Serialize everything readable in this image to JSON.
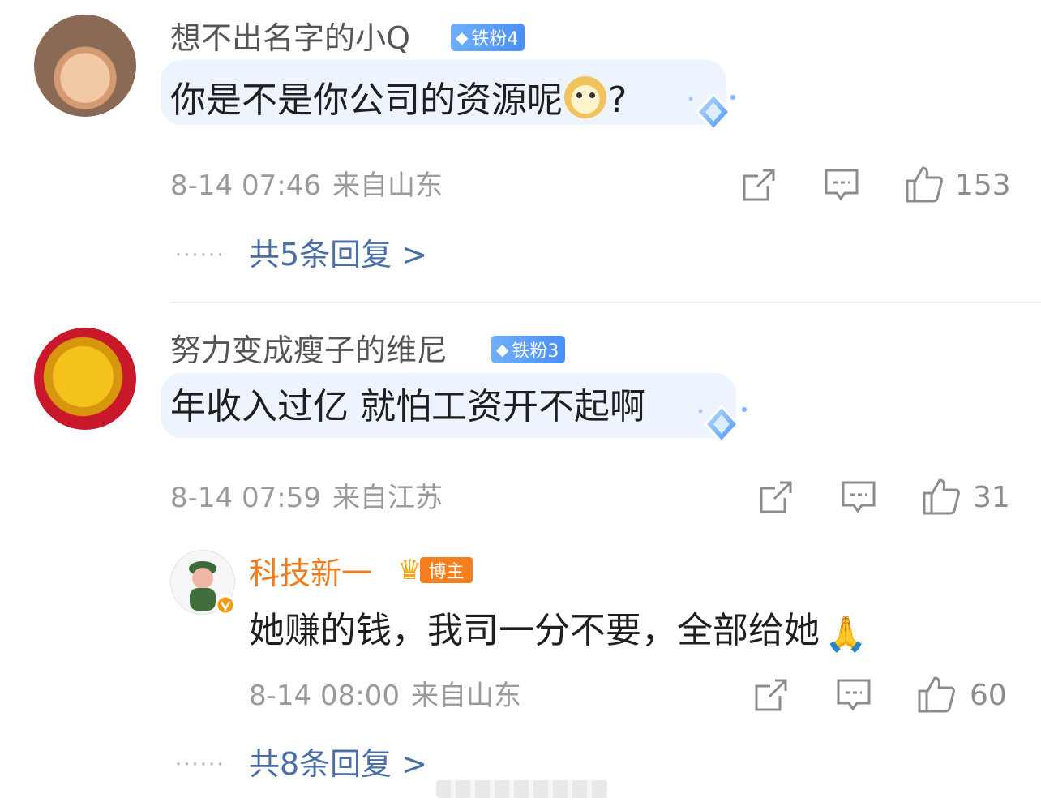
{
  "comments": [
    {
      "username": "想不出名字的小Q",
      "fan_badge": "铁粉4",
      "text": "你是不是你公司的资源呢",
      "text_suffix": "?",
      "timestamp": "8-14 07:46",
      "location": "来自山东",
      "likes": "153",
      "replies_link": "共5条回复 >"
    },
    {
      "username": "努力变成瘦子的维尼",
      "fan_badge": "铁粉3",
      "text": "年收入过亿 就怕工资开不起啊",
      "timestamp": "8-14 07:59",
      "location": "来自江苏",
      "likes": "31",
      "reply": {
        "username": "科技新一",
        "host_badge": "博主",
        "text": "她赚的钱，我司一分不要，全部给她",
        "timestamp": "8-14 08:00",
        "location": "来自山东",
        "likes": "60"
      },
      "replies_link": "共8条回复 >"
    }
  ],
  "dots": "······",
  "icons": [
    "share-icon",
    "comment-icon",
    "like-icon",
    "diamond-icon",
    "crown-icon",
    "verified-icon"
  ],
  "colors": {
    "link": "#4a6fa8",
    "blogger": "#f07c1b",
    "fan_badge": "#4a8ff5",
    "bubble": "#eef4fd"
  }
}
